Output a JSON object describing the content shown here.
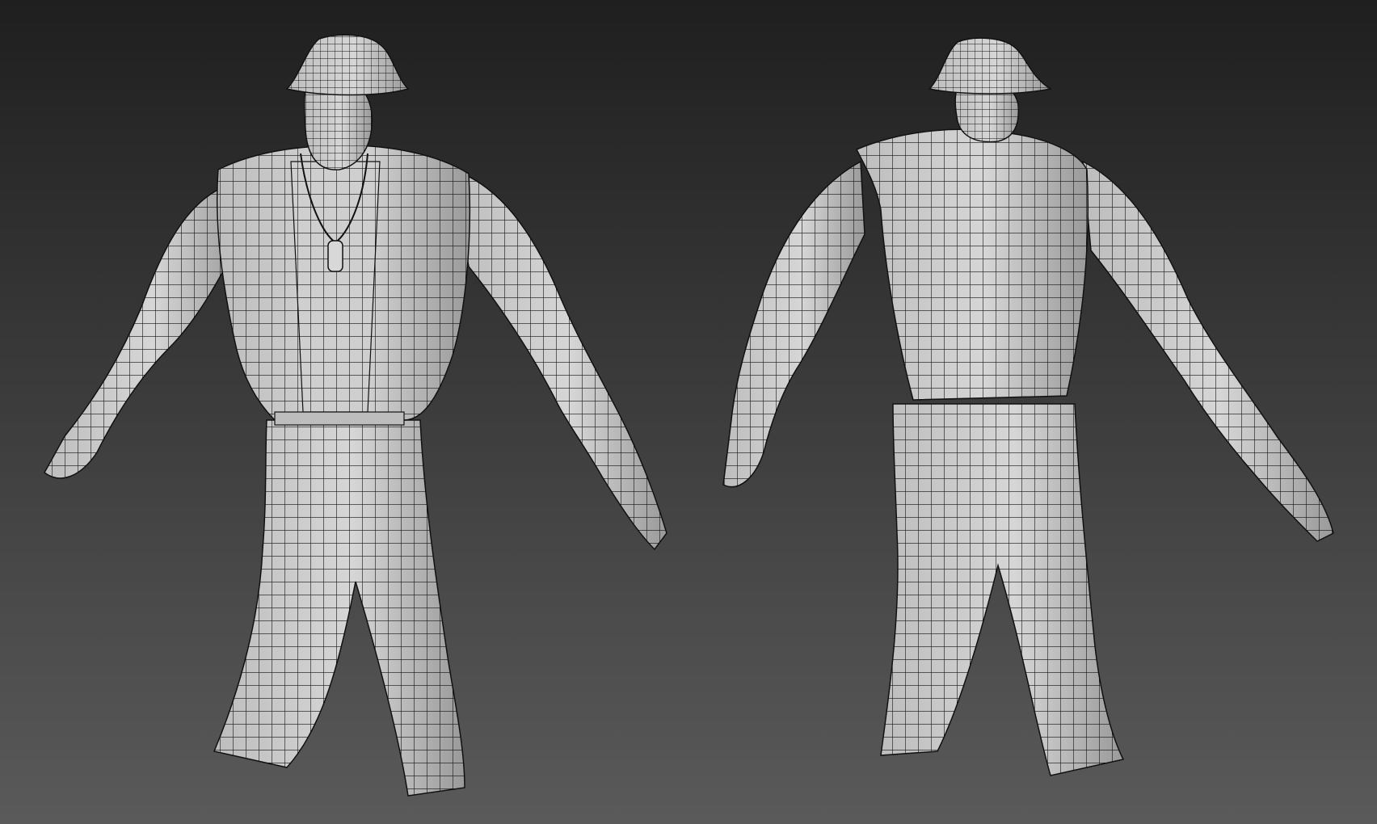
{
  "scene": {
    "background_top": "#1f1f1f",
    "background_bottom": "#5a5a5a",
    "mesh_fill": "#c9c9c9",
    "mesh_fill_shadow": "#8e8e8e",
    "wire_color": "#111111"
  },
  "models": [
    {
      "view": "front",
      "subject": "character-wireframe"
    },
    {
      "view": "back",
      "subject": "character-wireframe"
    }
  ]
}
